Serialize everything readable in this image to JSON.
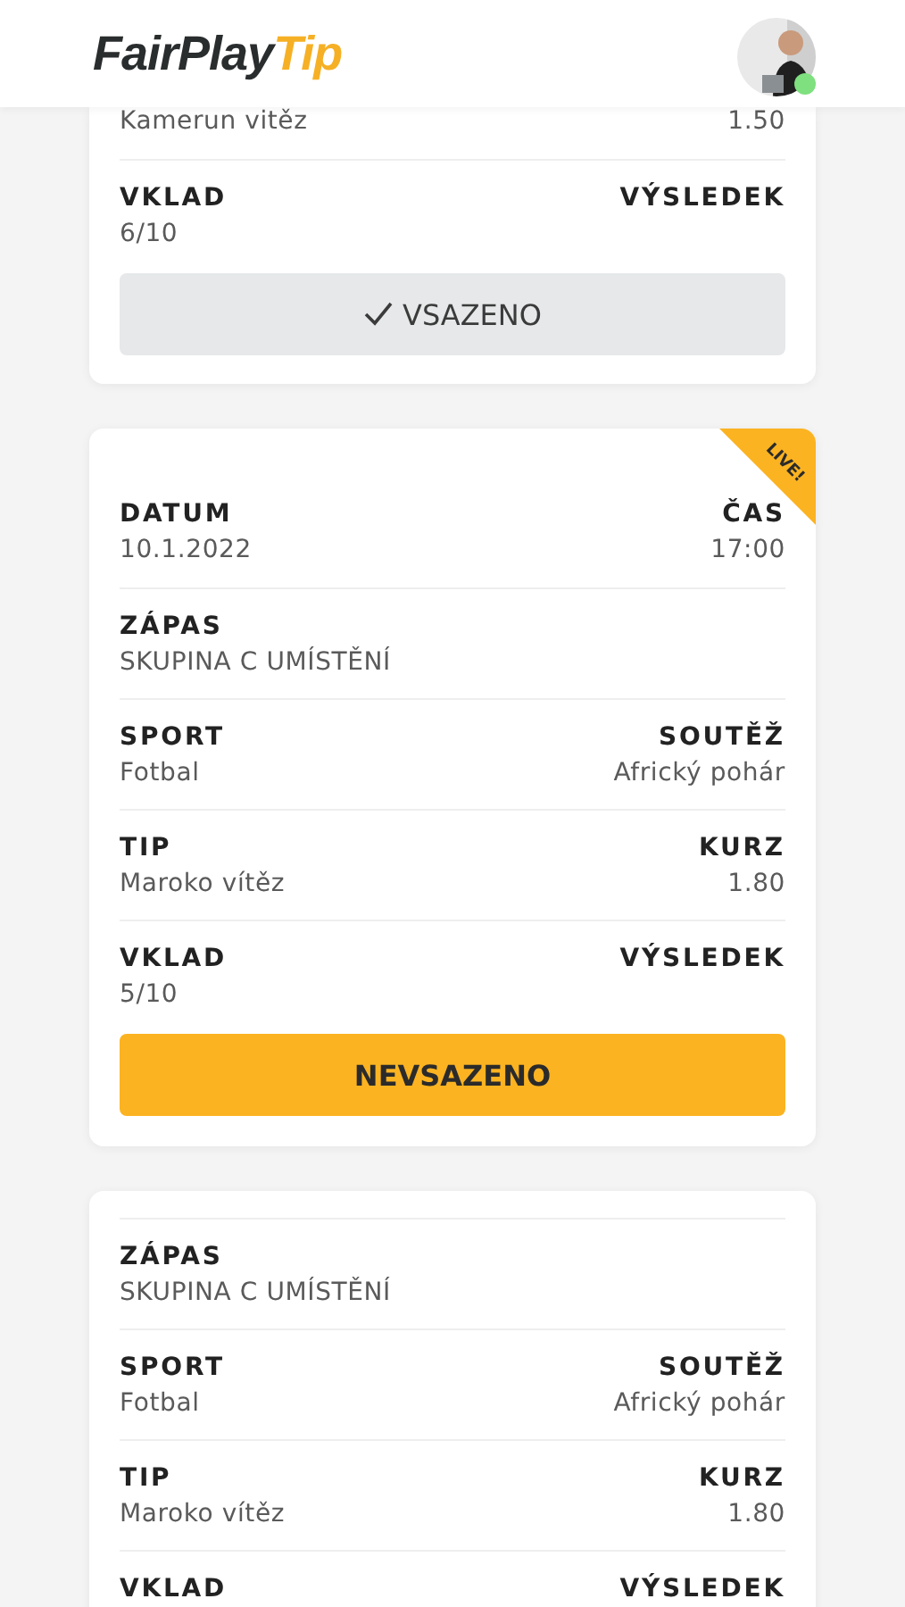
{
  "header": {
    "logo": {
      "main": "FairPlay",
      "accent": "Tip"
    },
    "avatar": {
      "online": true
    }
  },
  "cards": [
    {
      "clipped_top": true,
      "rows": [
        {
          "left": {
            "value": "Kamerun vitěz"
          },
          "right": {
            "value": "1.50"
          }
        },
        {
          "left": {
            "label": "VKLAD",
            "value": "6/10"
          },
          "right": {
            "label": "VÝSLEDEK"
          }
        }
      ],
      "button": {
        "label": "VSAZENO",
        "placed": true
      }
    },
    {
      "badge": "LIVE!",
      "rows": [
        {
          "left": {
            "label": "DATUM",
            "value": "10.1.2022"
          },
          "right": {
            "label": "ČAS",
            "value": "17:00"
          }
        },
        {
          "left": {
            "label": "ZÁPAS",
            "value": "SKUPINA C UMÍSTĚNÍ"
          }
        },
        {
          "left": {
            "label": "SPORT",
            "value": "Fotbal"
          },
          "right": {
            "label": "SOUTĚŽ",
            "value": "Africký pohár"
          }
        },
        {
          "left": {
            "label": "TIP",
            "value": "Maroko vítěz"
          },
          "right": {
            "label": "KURZ",
            "value": "1.80"
          }
        },
        {
          "left": {
            "label": "VKLAD",
            "value": "5/10"
          },
          "right": {
            "label": "VÝSLEDEK"
          }
        }
      ],
      "button": {
        "label": "NEVSAZENO",
        "placed": false
      }
    },
    {
      "top_rule": true,
      "rows": [
        {
          "left": {
            "label": "ZÁPAS",
            "value": "SKUPINA C UMÍSTĚNÍ"
          }
        },
        {
          "left": {
            "label": "SPORT",
            "value": "Fotbal"
          },
          "right": {
            "label": "SOUTĚŽ",
            "value": "Africký pohár"
          }
        },
        {
          "left": {
            "label": "TIP",
            "value": "Maroko vítěz"
          },
          "right": {
            "label": "KURZ",
            "value": "1.80"
          }
        },
        {
          "left": {
            "label": "VKLAD"
          },
          "right": {
            "label": "VÝSLEDEK"
          }
        }
      ]
    }
  ]
}
